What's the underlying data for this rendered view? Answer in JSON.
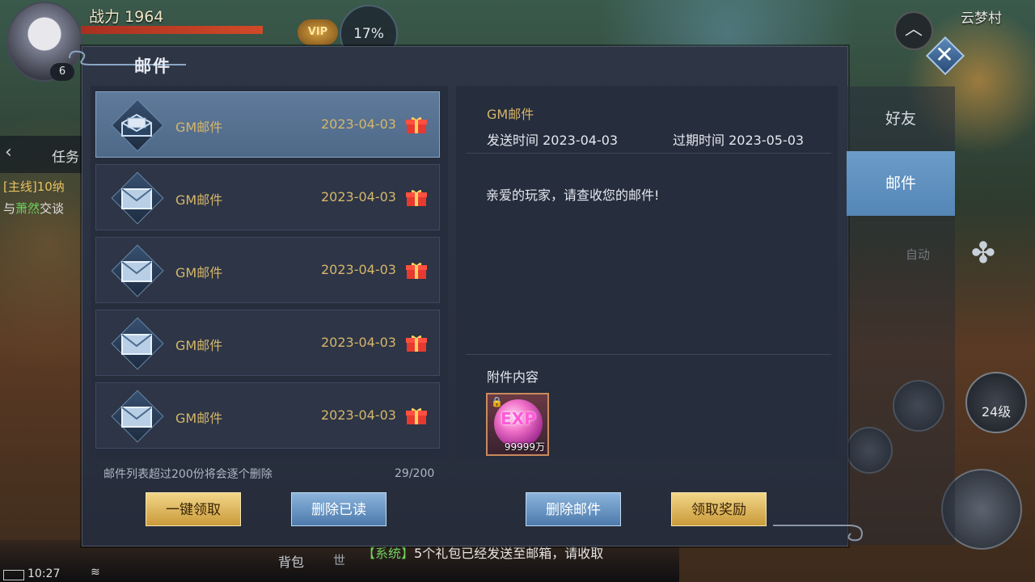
{
  "hud": {
    "power_label": "战力",
    "power_value": "1964",
    "level": "6",
    "vip_label": "VIP",
    "progress_text": "17%",
    "location": "云梦村",
    "task_label": "任务",
    "quest_line1": "[主线]10纳",
    "quest_line2_prefix": "与",
    "quest_line2_highlight": "萧然",
    "quest_line2_suffix": "交谈",
    "auto_label": "自动",
    "level_badge": "24级",
    "bag_label": "背包",
    "world_label": "世",
    "system_tag": "【系统】",
    "system_message": "5个礼包已经发送至邮箱，请收取",
    "clock": "10:27"
  },
  "window": {
    "title": "邮件",
    "close_label": "✕"
  },
  "tabs": [
    {
      "label": "好友",
      "active": false
    },
    {
      "label": "邮件",
      "active": true
    }
  ],
  "mail_list": [
    {
      "name": "GM邮件",
      "date": "2023-04-03",
      "selected": true
    },
    {
      "name": "GM邮件",
      "date": "2023-04-03",
      "selected": false
    },
    {
      "name": "GM邮件",
      "date": "2023-04-03",
      "selected": false
    },
    {
      "name": "GM邮件",
      "date": "2023-04-03",
      "selected": false
    },
    {
      "name": "GM邮件",
      "date": "2023-04-03",
      "selected": false
    }
  ],
  "list_footer": {
    "tip": "邮件列表超过200份将会逐个删除",
    "count": "29/200"
  },
  "detail": {
    "title": "GM邮件",
    "send_label": "发送时间",
    "send_date": "2023-04-03",
    "expire_label": "过期时间",
    "expire_date": "2023-05-03",
    "body": "亲爱的玩家，请查收您的邮件!",
    "attachments_label": "附件内容",
    "attachment": {
      "icon": "exp-orb-icon",
      "text": "EXP",
      "quantity": "99999万",
      "locked": true
    }
  },
  "buttons": {
    "claim_all": "一键领取",
    "delete_read": "删除已读",
    "delete_mail": "删除邮件",
    "claim_reward": "领取奖励"
  },
  "colors": {
    "gold_text": "#d6b66a",
    "active_tab": "#5f90c0",
    "selected_item": "#5a7494"
  }
}
